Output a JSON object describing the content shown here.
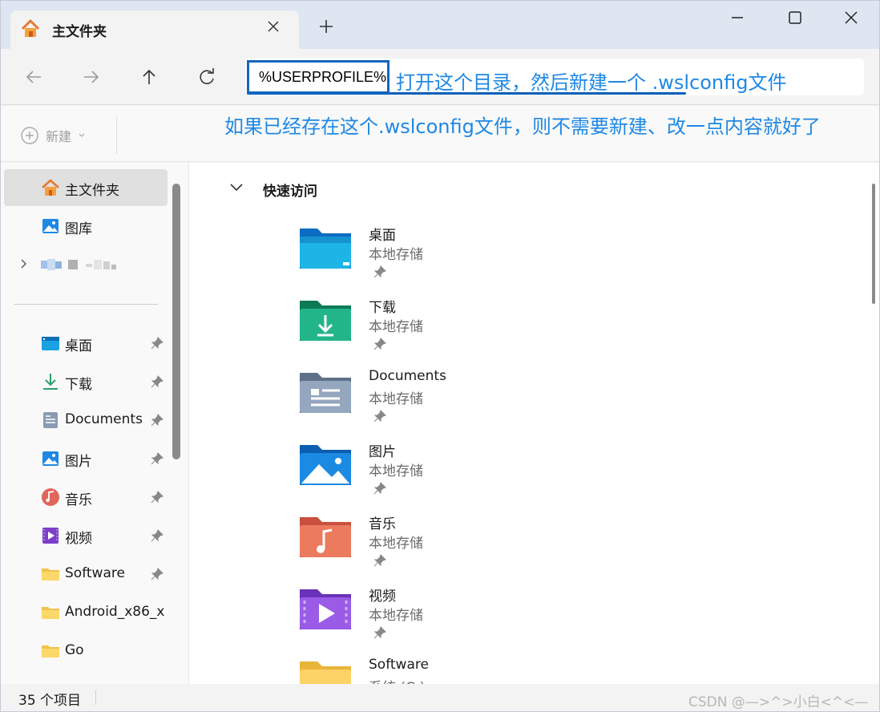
{
  "tab": {
    "title": "主文件夹",
    "icon": "home-icon"
  },
  "window_controls": [
    "minimize-icon",
    "maximize-icon",
    "close-icon"
  ],
  "address": {
    "path": "%USERPROFILE%"
  },
  "annotations": {
    "line1": "打开这个目录，然后新建一个 .wslconfig文件",
    "line2": "如果已经存在这个.wslconfig文件，则不需要新建、改一点内容就好了",
    "color": "#1e88e5"
  },
  "command_bar": {
    "new_label": "新建"
  },
  "sidebar": {
    "top_items": [
      {
        "label": "主文件夹",
        "icon": "home-icon",
        "selected": true
      },
      {
        "label": "图库",
        "icon": "gallery-icon"
      },
      {
        "label": "",
        "icon": "user-account-icon",
        "expandable": true
      }
    ],
    "pinned_items": [
      {
        "label": "桌面",
        "icon": "desktop-icon",
        "pinned": true
      },
      {
        "label": "下载",
        "icon": "download-icon",
        "pinned": true
      },
      {
        "label": "Documents",
        "icon": "documents-icon",
        "pinned": true
      },
      {
        "label": "图片",
        "icon": "pictures-icon",
        "pinned": true
      },
      {
        "label": "音乐",
        "icon": "music-icon",
        "pinned": true
      },
      {
        "label": "视频",
        "icon": "videos-icon",
        "pinned": true
      },
      {
        "label": "Software",
        "icon": "folder-icon",
        "pinned": true
      },
      {
        "label": "Android_x86_x",
        "icon": "folder-icon",
        "pinned": false
      },
      {
        "label": "Go",
        "icon": "folder-icon",
        "pinned": false
      }
    ]
  },
  "main": {
    "section_title": "快速访问",
    "quick_access": [
      {
        "name": "桌面",
        "sub": "本地存储",
        "icon": "desktop-folder-icon"
      },
      {
        "name": "下载",
        "sub": "本地存储",
        "icon": "downloads-folder-icon"
      },
      {
        "name": "Documents",
        "sub": "本地存储",
        "icon": "documents-folder-icon"
      },
      {
        "name": "图片",
        "sub": "本地存储",
        "icon": "pictures-folder-icon"
      },
      {
        "name": "音乐",
        "sub": "本地存储",
        "icon": "music-folder-icon"
      },
      {
        "name": "视频",
        "sub": "本地存储",
        "icon": "videos-folder-icon"
      },
      {
        "name": "Software",
        "sub": "系统 (C:)",
        "icon": "folder-icon"
      }
    ]
  },
  "status": {
    "item_count": "35 个项目"
  },
  "watermark": "CSDN @—>^>小白<^<—"
}
